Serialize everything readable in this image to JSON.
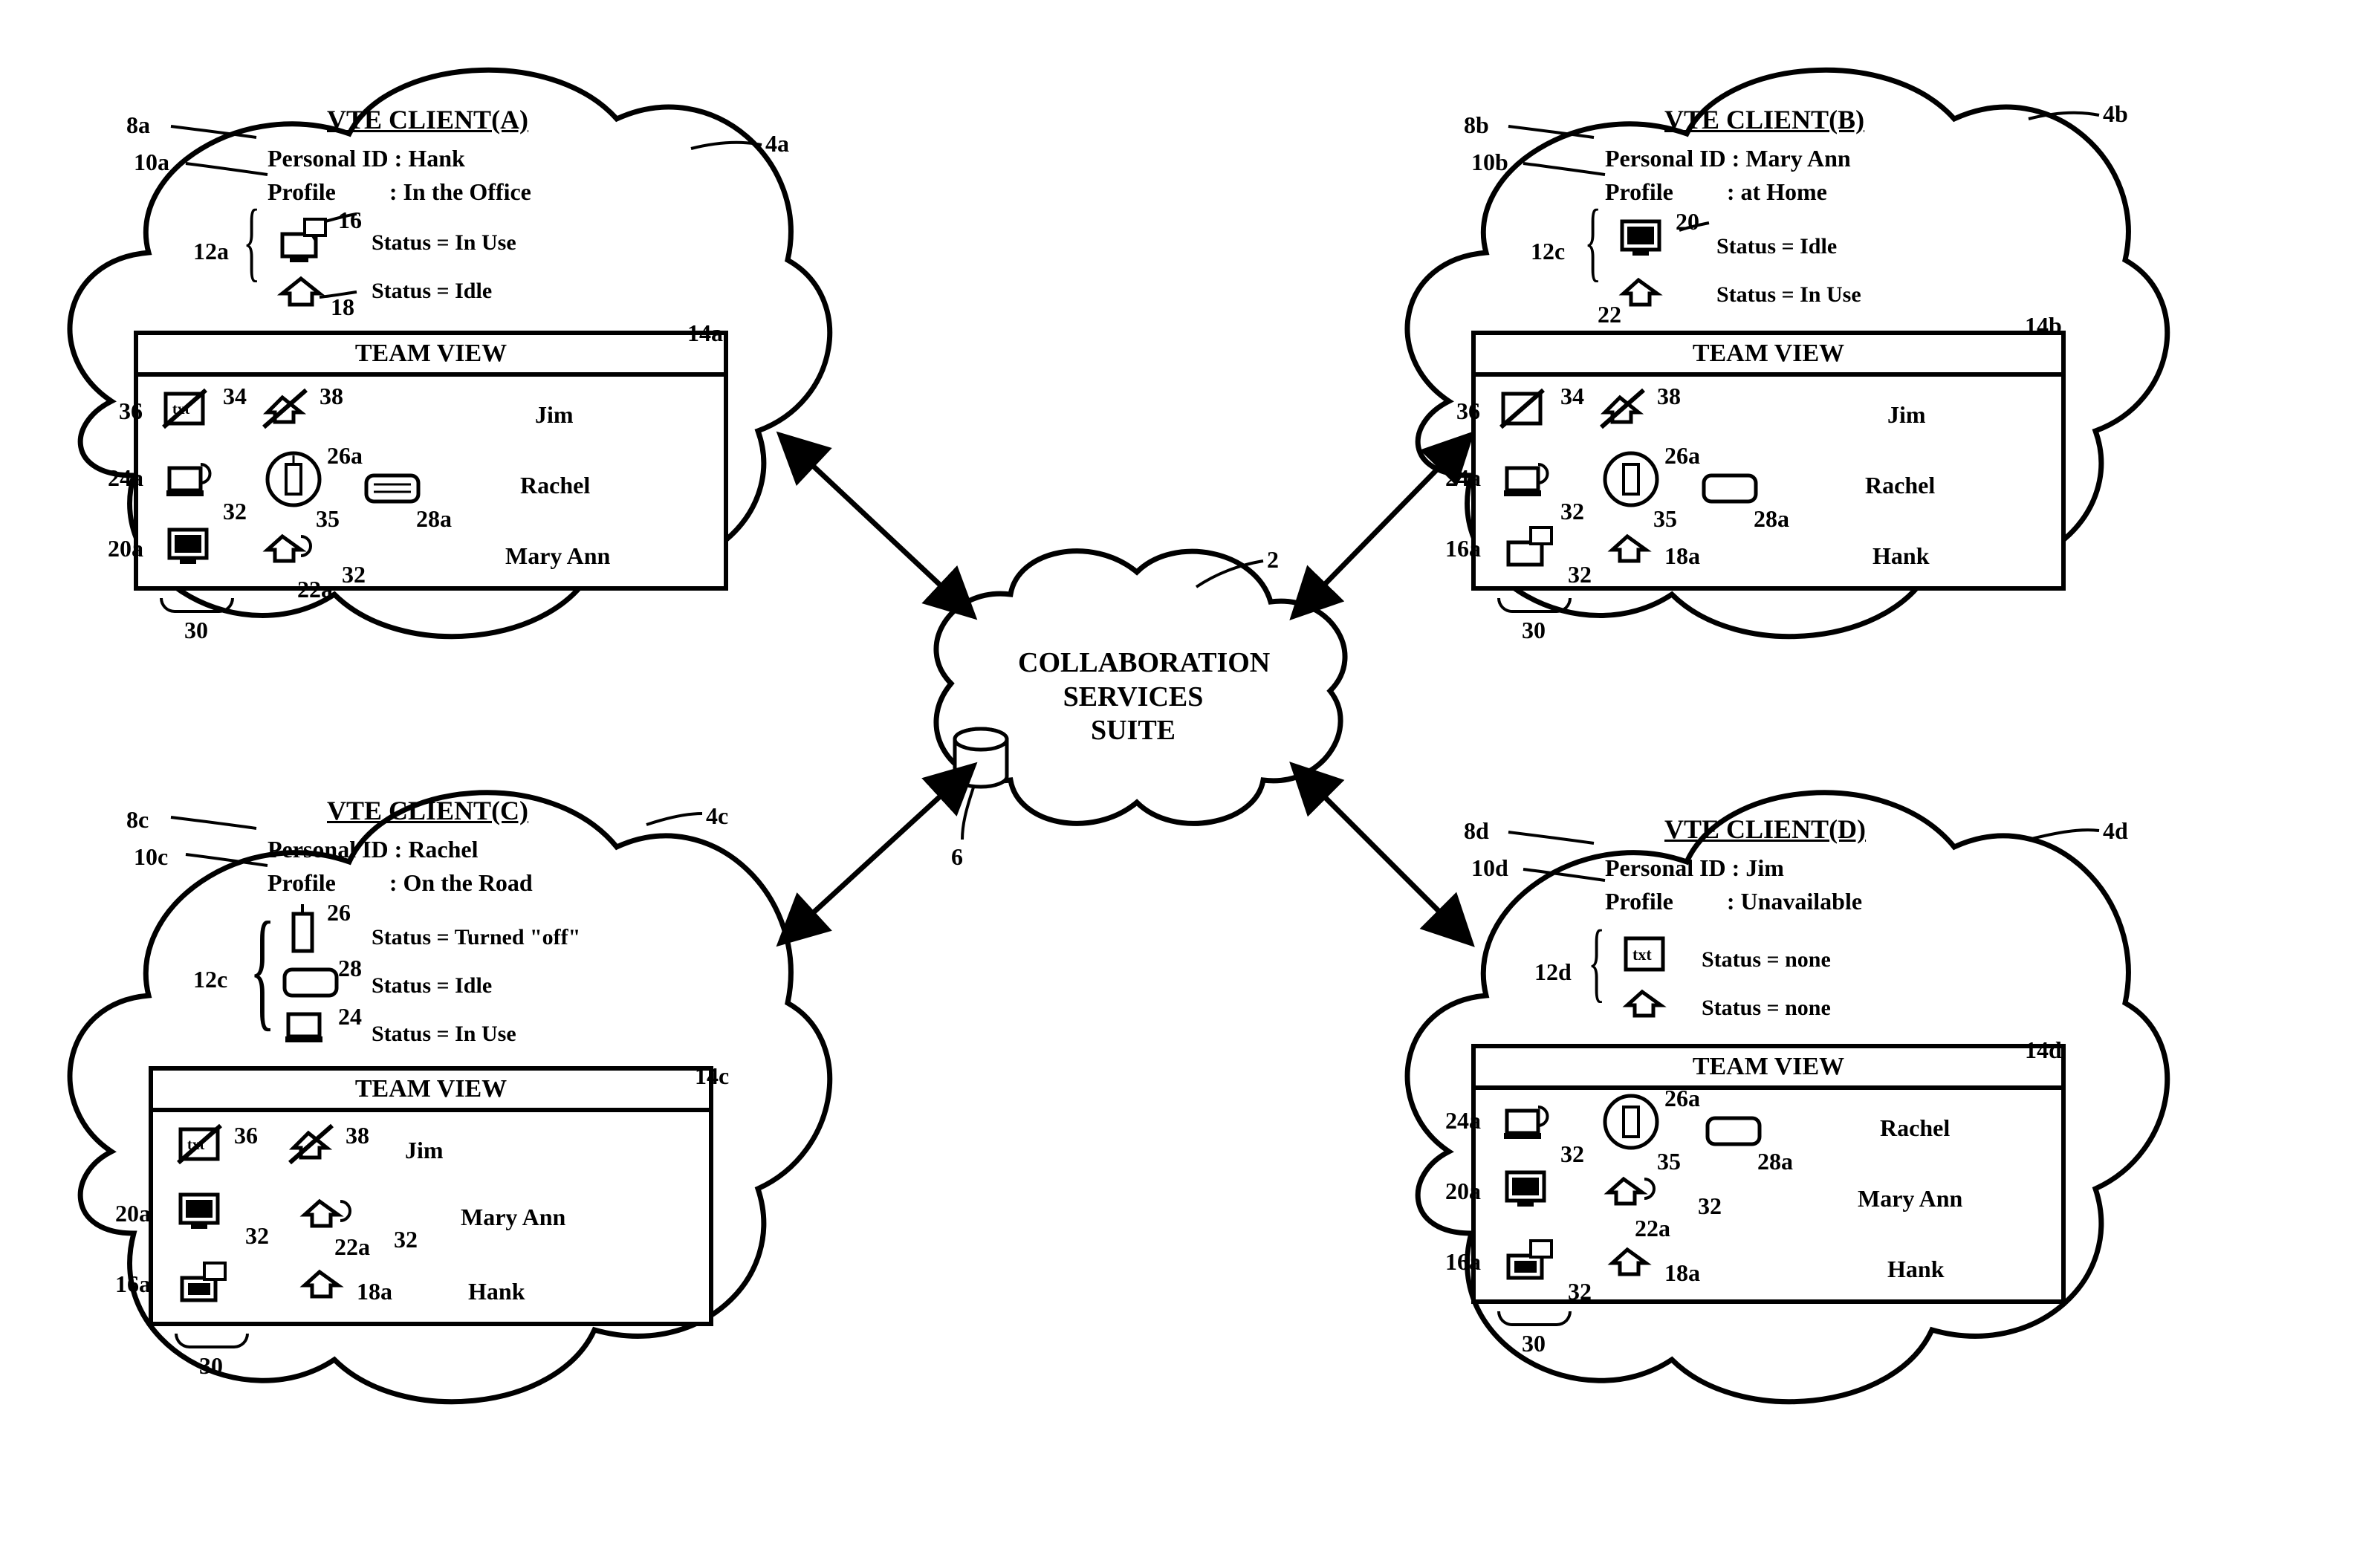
{
  "center": {
    "label": "COLLABORATION\nSERVICES SUITE",
    "ref": "2",
    "db_ref": "6"
  },
  "clients": {
    "a": {
      "title": "VTE CLIENT(A)",
      "cloud_ref": "4a",
      "id_label": "Personal ID",
      "id_value": "Hank",
      "id_ref": "8a",
      "profile_label": "Profile",
      "profile_value": "In the Office",
      "profile_ref": "10a",
      "devices_ref": "12a",
      "dev1_ref": "16",
      "dev1_status": "Status = In Use",
      "dev2_ref": "18",
      "dev2_status": "Status = Idle",
      "tv_ref": "14a",
      "tv_title": "TEAM VIEW",
      "tv_rows": [
        {
          "name": "Jim",
          "refs": [
            "36",
            "34",
            "38"
          ]
        },
        {
          "name": "Rachel",
          "refs": [
            "24a",
            "32",
            "26a",
            "35",
            "28a"
          ]
        },
        {
          "name": "Mary Ann",
          "refs": [
            "20a",
            "22a",
            "32"
          ]
        }
      ],
      "bottom_ref": "30"
    },
    "b": {
      "title": "VTE CLIENT(B)",
      "cloud_ref": "4b",
      "id_label": "Personal ID",
      "id_value": "Mary Ann",
      "id_ref": "8b",
      "profile_label": "Profile",
      "profile_value": "at Home",
      "profile_ref": "10b",
      "devices_ref": "12c",
      "dev1_ref": "20",
      "dev1_status": "Status = Idle",
      "dev2_ref": "22",
      "dev2_status": "Status = In Use",
      "tv_ref": "14b",
      "tv_title": "TEAM VIEW",
      "tv_rows": [
        {
          "name": "Jim",
          "refs": [
            "36",
            "34",
            "38"
          ]
        },
        {
          "name": "Rachel",
          "refs": [
            "24a",
            "32",
            "26a",
            "35",
            "28a"
          ]
        },
        {
          "name": "Hank",
          "refs": [
            "16a",
            "32",
            "18a"
          ]
        }
      ],
      "bottom_ref": "30"
    },
    "c": {
      "title": "VTE CLIENT(C)",
      "cloud_ref": "4c",
      "id_label": "Personal ID",
      "id_value": "Rachel",
      "id_ref": "8c",
      "profile_label": "Profile",
      "profile_value": "On the Road",
      "profile_ref": "10c",
      "devices_ref": "12c",
      "dev1_ref": "26",
      "dev1_status": "Status = Turned \"off\"",
      "dev2_ref": "28",
      "dev2_status": "Status = Idle",
      "dev3_ref": "24",
      "dev3_status": "Status = In Use",
      "tv_ref": "14c",
      "tv_title": "TEAM VIEW",
      "tv_rows": [
        {
          "name": "Jim",
          "refs": [
            "36",
            "38"
          ]
        },
        {
          "name": "Mary Ann",
          "refs": [
            "20a",
            "32",
            "22a",
            "32"
          ]
        },
        {
          "name": "Hank",
          "refs": [
            "16a",
            "18a"
          ]
        }
      ],
      "bottom_ref": "30"
    },
    "d": {
      "title": "VTE CLIENT(D)",
      "cloud_ref": "4d",
      "id_label": "Personal ID",
      "id_value": "Jim",
      "id_ref": "8d",
      "profile_label": "Profile",
      "profile_value": "Unavailable",
      "profile_ref": "10d",
      "devices_ref": "12d",
      "dev1_status": "Status = none",
      "dev2_status": "Status = none",
      "tv_ref": "14d",
      "tv_title": "TEAM VIEW",
      "tv_rows": [
        {
          "name": "Rachel",
          "refs": [
            "24a",
            "32",
            "26a",
            "35",
            "28a"
          ]
        },
        {
          "name": "Mary Ann",
          "refs": [
            "20a",
            "22a",
            "32"
          ]
        },
        {
          "name": "Hank",
          "refs": [
            "16a",
            "32",
            "18a"
          ]
        }
      ],
      "bottom_ref": "30"
    }
  },
  "icons": {
    "txt": "txt"
  }
}
